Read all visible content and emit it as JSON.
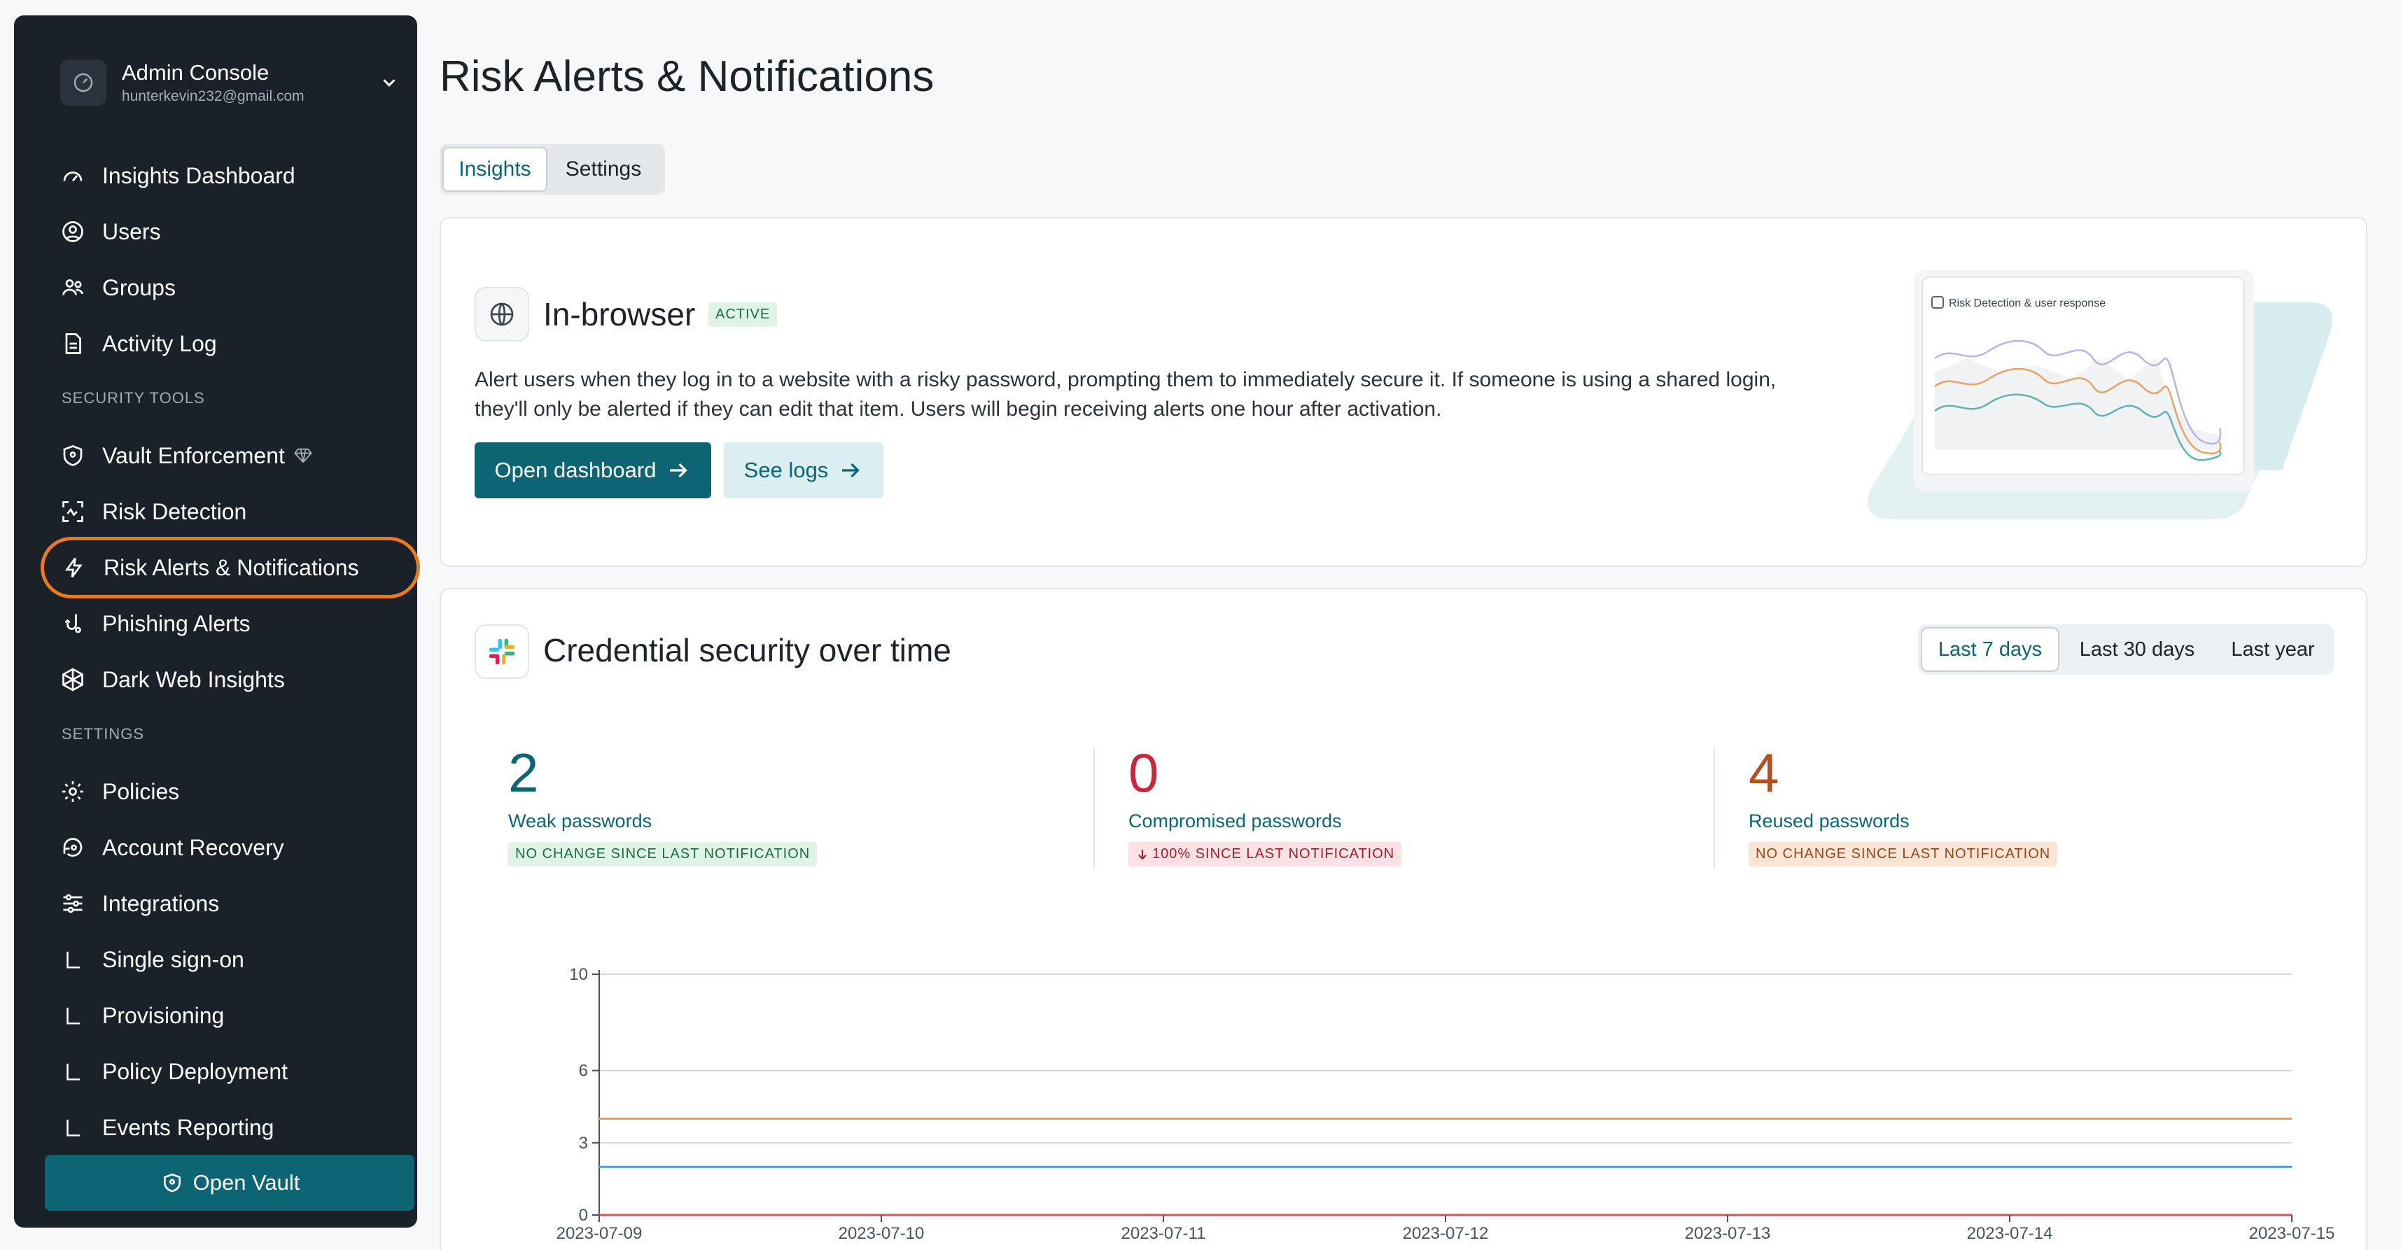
{
  "sidebar": {
    "account": {
      "title": "Admin Console",
      "email": "hunterkevin232@gmail.com"
    },
    "items": [
      {
        "label": "Insights Dashboard",
        "icon": "gauge-icon"
      },
      {
        "label": "Users",
        "icon": "user-circle-icon"
      },
      {
        "label": "Groups",
        "icon": "users-icon"
      },
      {
        "label": "Activity Log",
        "icon": "document-icon"
      }
    ],
    "security_label": "SECURITY TOOLS",
    "security_items": [
      {
        "label": "Vault Enforcement",
        "icon": "shield-icon"
      },
      {
        "label": "Risk Detection",
        "icon": "scan-icon"
      },
      {
        "label": "Risk Alerts & Notifications",
        "icon": "bolt-icon"
      },
      {
        "label": "Phishing Alerts",
        "icon": "phishing-icon"
      },
      {
        "label": "Dark Web Insights",
        "icon": "globe-cube-icon"
      }
    ],
    "settings_label": "SETTINGS",
    "settings_items": [
      {
        "label": "Policies",
        "icon": "gear-icon"
      },
      {
        "label": "Account Recovery",
        "icon": "key-icon"
      },
      {
        "label": "Integrations",
        "icon": "sliders-icon"
      },
      {
        "label": "Single sign-on",
        "icon": "sub-item-icon"
      },
      {
        "label": "Provisioning",
        "icon": "sub-item-icon"
      },
      {
        "label": "Policy Deployment",
        "icon": "sub-item-icon"
      },
      {
        "label": "Events Reporting",
        "icon": "sub-item-icon"
      }
    ],
    "open_vault": "Open Vault"
  },
  "page": {
    "title": "Risk Alerts & Notifications",
    "tabs": [
      {
        "label": "Insights"
      },
      {
        "label": "Settings"
      }
    ]
  },
  "in_browser": {
    "title": "In-browser",
    "badge": "ACTIVE",
    "description_line1": "Alert users when they log in to a website with a risky password, prompting them to immediately secure it. If someone is using a shared login,",
    "description_line2": "they'll only be alerted if they can edit that item. Users will begin receiving alerts one hour after activation.",
    "open_dashboard": "Open dashboard",
    "see_logs": "See logs",
    "preview_title": "Risk Detection & user response"
  },
  "credential": {
    "title": "Credential security over time",
    "ranges": [
      "Last 7 days",
      "Last 30 days",
      "Last year"
    ],
    "stats": [
      {
        "value": "2",
        "label": "Weak passwords",
        "badge": "NO CHANGE SINCE LAST NOTIFICATION"
      },
      {
        "value": "0",
        "label": "Compromised passwords",
        "badge": "100% SINCE LAST NOTIFICATION"
      },
      {
        "value": "4",
        "label": "Reused passwords",
        "badge": "NO CHANGE SINCE LAST NOTIFICATION"
      }
    ]
  },
  "colors": {
    "accent": "#0d6573",
    "weak": "#0d6573",
    "compromised": "#c8283a",
    "reused": "#b4501e",
    "highlight_ring": "#e97a1e"
  },
  "chart_data": {
    "type": "line",
    "x": [
      "2023-07-09",
      "2023-07-10",
      "2023-07-11",
      "2023-07-12",
      "2023-07-13",
      "2023-07-14",
      "2023-07-15"
    ],
    "y_ticks": [
      "10",
      "6",
      "3",
      "0"
    ],
    "ylim": [
      0,
      10
    ],
    "series": [
      {
        "values": [
          4,
          4,
          4,
          4,
          4,
          4,
          4
        ],
        "color": "#f09a4a"
      },
      {
        "values": [
          2,
          2,
          2,
          2,
          2,
          2,
          2
        ],
        "color": "#4a9fd8"
      },
      {
        "values": [
          0,
          0,
          0,
          0,
          0,
          0,
          0
        ],
        "color": "#e04b5a"
      }
    ],
    "grid": true
  }
}
